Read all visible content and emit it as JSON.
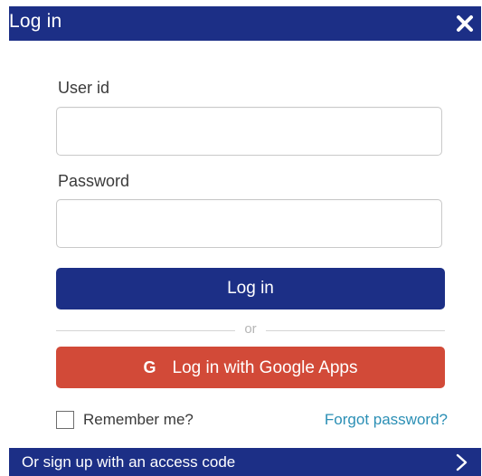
{
  "header": {
    "title": "Log in",
    "close_icon": "close-icon"
  },
  "form": {
    "user_id_label": "User id",
    "user_id_value": "",
    "password_label": "Password",
    "password_value": "",
    "login_button": "Log in",
    "divider_text": "or",
    "google_button": "Log in with Google Apps",
    "google_icon_glyph": "G",
    "remember_label": "Remember me?",
    "remember_checked": false,
    "forgot_link": "Forgot password?"
  },
  "footer": {
    "text": "Or sign up with an access code",
    "icon": "chevron-right-icon"
  },
  "colors": {
    "primary": "#1c2f86",
    "google": "#d24a38",
    "link": "#2b8fb5",
    "border": "#c9c9c9"
  }
}
